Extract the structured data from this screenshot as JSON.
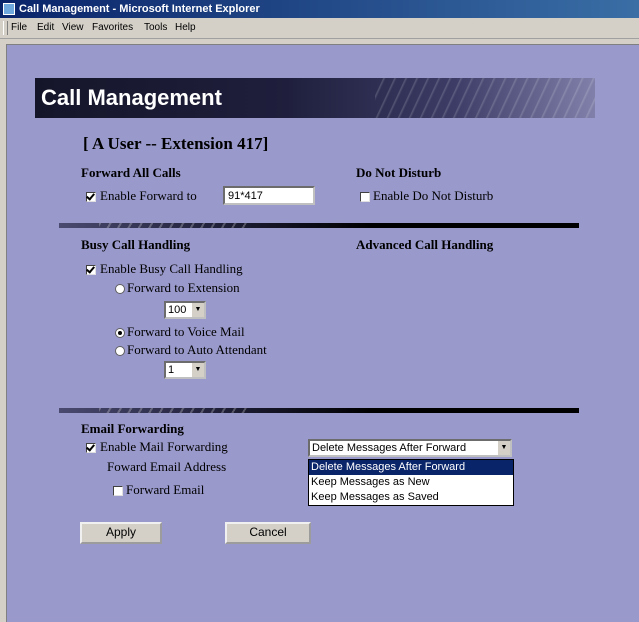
{
  "window": {
    "title": "Call Management - Microsoft Internet Explorer"
  },
  "menu": [
    "File",
    "Edit",
    "View",
    "Favorites",
    "Tools",
    "Help"
  ],
  "banner": {
    "title": "Call Management"
  },
  "user": {
    "heading": "[ A User   -- Extension 417]"
  },
  "forward_all": {
    "label": "Forward All Calls",
    "checkbox_label": "Enable Forward to",
    "checked": true,
    "number": "91*417"
  },
  "dnd": {
    "label": "Do Not Disturb",
    "checkbox_label": "Enable Do Not Disturb",
    "checked": false
  },
  "busy": {
    "label": "Busy Call Handling",
    "enable_label": "Enable Busy Call Handling",
    "enabled": true,
    "forward_ext_label": "Forward to Extension",
    "ext_value": "100",
    "forward_vm_label": "Forward to Voice Mail",
    "forward_aa_label": "Forward to Auto Attendant",
    "aa_value": "1",
    "selected_option": "voice_mail"
  },
  "advanced": {
    "label": "Advanced Call Handling"
  },
  "email": {
    "label": "Email Forwarding",
    "enable_label": "Enable Mail Forwarding",
    "enabled": true,
    "address_label": "Foward Email Address",
    "forward_email_label": "Forward Email",
    "forward_email_checked": false,
    "select_value": "Delete Messages After Forward",
    "options": [
      "Delete Messages After Forward",
      "Keep Messages as New",
      "Keep Messages as Saved"
    ]
  },
  "buttons": {
    "apply": "Apply",
    "cancel": "Cancel"
  }
}
